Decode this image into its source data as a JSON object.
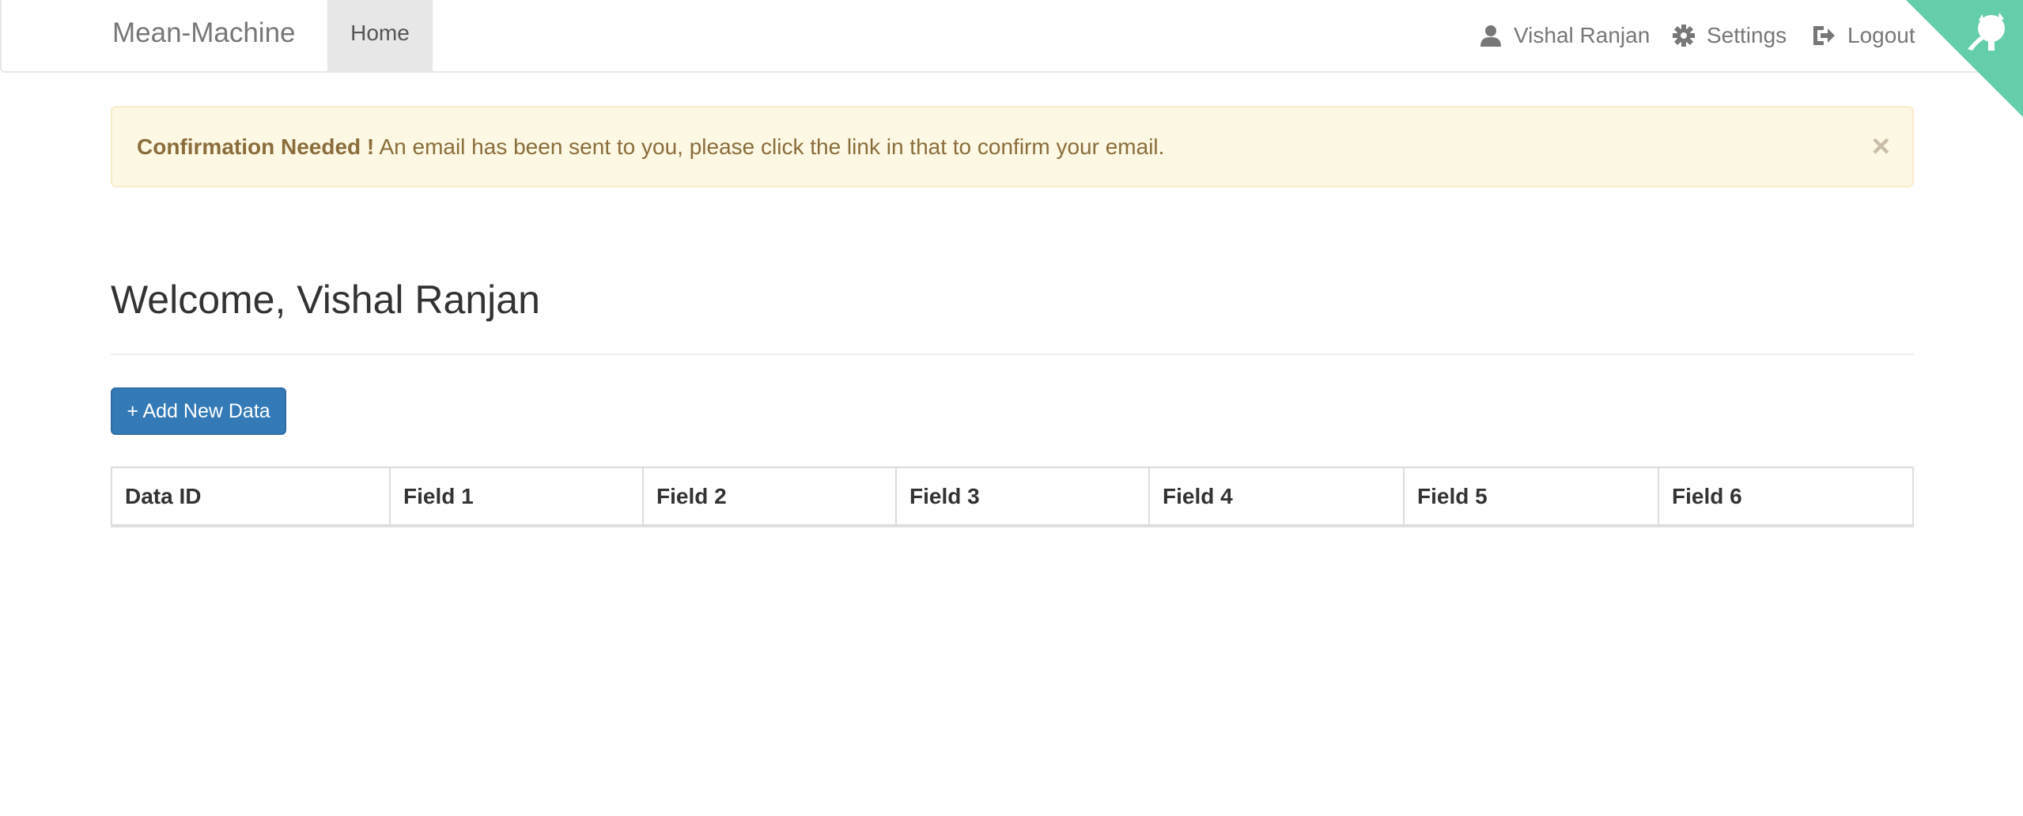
{
  "navbar": {
    "brand": "Mean-Machine",
    "home_label": "Home",
    "user_name": "Vishal Ranjan",
    "settings_label": "Settings",
    "logout_label": "Logout",
    "user_icon": "user-icon",
    "settings_icon": "gear-icon",
    "logout_icon": "logout-icon",
    "corner_icon": "github-octocat-icon",
    "corner_color": "#64ceaa"
  },
  "alert": {
    "title": "Confirmation Needed !",
    "message": " An email has been sent to you, please click the link in that to confirm your email.",
    "close": "×",
    "background": "#fcf8e3",
    "text_color": "#8a6d3b"
  },
  "main": {
    "welcome": "Welcome, Vishal Ranjan",
    "add_button": "+ Add New Data",
    "button_color": "#337ab7",
    "table": {
      "headers": [
        "Data ID",
        "Field 1",
        "Field 2",
        "Field 3",
        "Field 4",
        "Field 5",
        "Field 6"
      ],
      "rows": []
    }
  }
}
